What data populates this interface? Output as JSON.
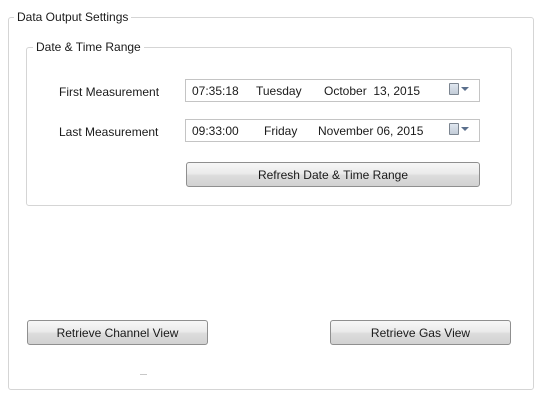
{
  "outer_group": {
    "title": "Data Output Settings"
  },
  "date_range_group": {
    "title": "Date & Time Range"
  },
  "first_measurement": {
    "label": "First Measurement",
    "time": "07:35:18",
    "weekday": "Tuesday",
    "date": "October  13, 2015"
  },
  "last_measurement": {
    "label": "Last Measurement",
    "time": "09:33:00",
    "weekday": "Friday",
    "date": "November 06, 2015"
  },
  "buttons": {
    "refresh": "Refresh Date & Time Range",
    "channel_view": "Retrieve Channel View",
    "gas_view": "Retrieve Gas View"
  },
  "icons": {
    "calendar": "calendar-icon",
    "dropdown": "chevron-down-icon"
  }
}
